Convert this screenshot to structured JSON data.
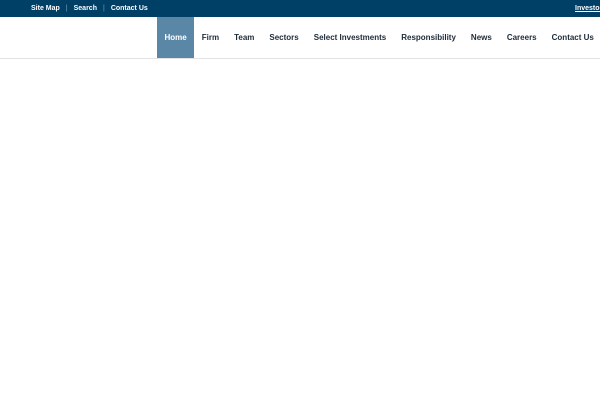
{
  "utility_links": [
    "Site Map",
    "Search",
    "Contact Us"
  ],
  "investor_link": "Investor",
  "nav": [
    {
      "label": "Home",
      "active": true
    },
    {
      "label": "Firm"
    },
    {
      "label": "Team"
    },
    {
      "label": "Sectors"
    },
    {
      "label": "Select Investments"
    },
    {
      "label": "Responsibility"
    },
    {
      "label": "News"
    },
    {
      "label": "Careers"
    },
    {
      "label": "Contact Us"
    }
  ],
  "colors": {
    "topbar": "#003f66",
    "active_tab": "#5b87a6"
  }
}
